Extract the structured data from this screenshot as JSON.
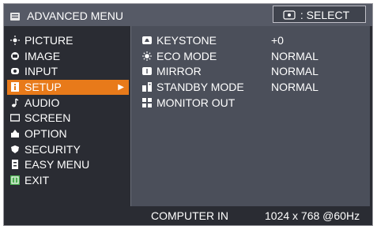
{
  "header": {
    "title": "ADVANCED MENU",
    "select_label": ": SELECT"
  },
  "menu": [
    {
      "label": "PICTURE",
      "icon": "picture-icon"
    },
    {
      "label": "IMAGE",
      "icon": "image-icon"
    },
    {
      "label": "INPUT",
      "icon": "input-icon"
    },
    {
      "label": "SETUP",
      "icon": "setup-icon",
      "active": true
    },
    {
      "label": "AUDIO",
      "icon": "audio-icon"
    },
    {
      "label": "SCREEN",
      "icon": "screen-icon"
    },
    {
      "label": "OPTION",
      "icon": "option-icon"
    },
    {
      "label": "SECURITY",
      "icon": "security-icon"
    },
    {
      "label": "EASY MENU",
      "icon": "easy-menu-icon"
    },
    {
      "label": "EXIT",
      "icon": "exit-icon"
    }
  ],
  "setup_items": [
    {
      "label": "KEYSTONE",
      "value": "+0",
      "icon": "keystone-icon"
    },
    {
      "label": "ECO MODE",
      "value": "NORMAL",
      "icon": "eco-mode-icon"
    },
    {
      "label": "MIRROR",
      "value": "NORMAL",
      "icon": "mirror-icon"
    },
    {
      "label": "STANDBY MODE",
      "value": "NORMAL",
      "icon": "standby-mode-icon"
    },
    {
      "label": "MONITOR OUT",
      "value": "",
      "icon": "monitor-out-icon"
    }
  ],
  "status": {
    "source": "COMPUTER IN",
    "resolution": "1024 x 768 @60Hz"
  },
  "colors": {
    "accent": "#e87a1a",
    "panel": "#4b4f5a",
    "background": "#2a2c33"
  }
}
